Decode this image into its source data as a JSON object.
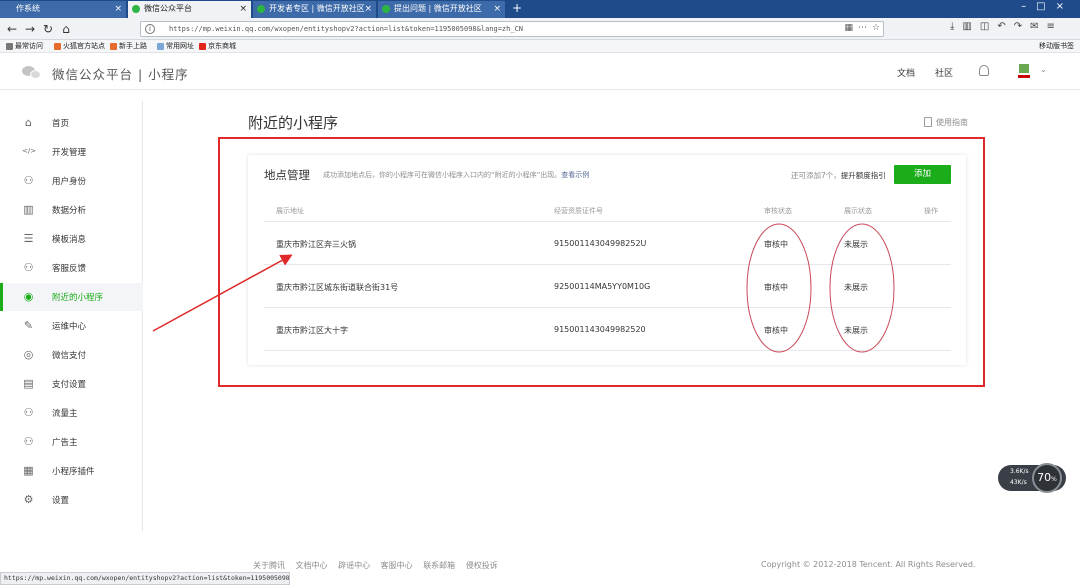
{
  "browser": {
    "tabs": [
      {
        "title": "作系统",
        "active": false
      },
      {
        "title": "微信公众平台",
        "active": true
      },
      {
        "title": "开发者专区 | 微信开放社区",
        "active": false
      },
      {
        "title": "提出问题 | 微信开放社区",
        "active": false
      }
    ],
    "url": "https://mp.weixin.qq.com/wxopen/entityshopv2?action=list&token=1195005098&lang=zh_CN",
    "status_url": "https://mp.weixin.qq.com/wxopen/entityshopv2?action=list&token=1195005098&lang=zh_CN",
    "bookmarks": [
      "最常访问",
      "火狐官方站点",
      "新手上路",
      "常用网址",
      "京东商城"
    ],
    "bookmarks_right": "移动版书签"
  },
  "header": {
    "brand": "微信公众平台 | 小程序",
    "links": [
      "文档",
      "社区"
    ]
  },
  "sidebar": {
    "items": [
      {
        "label": "首页",
        "icon": "home-icon",
        "glyph": "⌂",
        "active": false
      },
      {
        "label": "开发管理",
        "icon": "code-icon",
        "glyph": "</>",
        "active": false
      },
      {
        "label": "用户身份",
        "icon": "user-icon",
        "glyph": "⚇",
        "active": false
      },
      {
        "label": "数据分析",
        "icon": "chart-icon",
        "glyph": "▥",
        "active": false
      },
      {
        "label": "模板消息",
        "icon": "template-icon",
        "glyph": "☰",
        "active": false
      },
      {
        "label": "客服反馈",
        "icon": "support-icon",
        "glyph": "⚇",
        "active": false
      },
      {
        "label": "附近的小程序",
        "icon": "location-icon",
        "glyph": "◉",
        "active": true
      },
      {
        "label": "运维中心",
        "icon": "wrench-icon",
        "glyph": "✎",
        "active": false
      },
      {
        "label": "微信支付",
        "icon": "pay-icon",
        "glyph": "◎",
        "active": false
      },
      {
        "label": "支付设置",
        "icon": "pay-settings-icon",
        "glyph": "▤",
        "active": false
      },
      {
        "label": "流量主",
        "icon": "traffic-icon",
        "glyph": "⚇",
        "active": false
      },
      {
        "label": "广告主",
        "icon": "advertiser-icon",
        "glyph": "⚇",
        "active": false
      },
      {
        "label": "小程序插件",
        "icon": "plugin-icon",
        "glyph": "▦",
        "active": false
      },
      {
        "label": "设置",
        "icon": "gear-icon",
        "glyph": "⚙",
        "active": false
      }
    ]
  },
  "main": {
    "title": "附近的小程序",
    "guide_label": "使用指南",
    "card": {
      "title": "地点管理",
      "desc": "成功添加地点后，你的小程序可在微信小程序入口内的“附近的小程序”出现。",
      "desc_link": "查看示例",
      "quota": "还可添加7个，",
      "quota_link": "提升额度指引",
      "add_button": "添加",
      "columns": [
        "展示地址",
        "经营资质证件号",
        "审核状态",
        "展示状态",
        "操作"
      ],
      "rows": [
        {
          "address": "重庆市黔江区奔三火锅",
          "license": "915001143049​98252U",
          "review": "审核中",
          "display": "未展示"
        },
        {
          "address": "重庆市黔江区城东街道联合街31号",
          "license": "92500114MA5YY0M10G",
          "review": "审核中",
          "display": "未展示"
        },
        {
          "address": "重庆市黔江区大十字",
          "license": "915001143049982520",
          "review": "审核中",
          "display": "未展示"
        }
      ]
    }
  },
  "footer": {
    "links": [
      "关于腾讯",
      "文档中心",
      "辟谣中心",
      "客服中心",
      "联系邮箱",
      "侵权投诉"
    ],
    "copyright": "Copyright © 2012-2018 Tencent. All Rights Reserved."
  },
  "net_widget": {
    "up": "3.6K/s",
    "down": "43K/s",
    "percent": "70",
    "percent_unit": "%"
  },
  "colors": {
    "accent": "#1aad19",
    "annotation": "#e0292a",
    "link": "#576b95"
  }
}
